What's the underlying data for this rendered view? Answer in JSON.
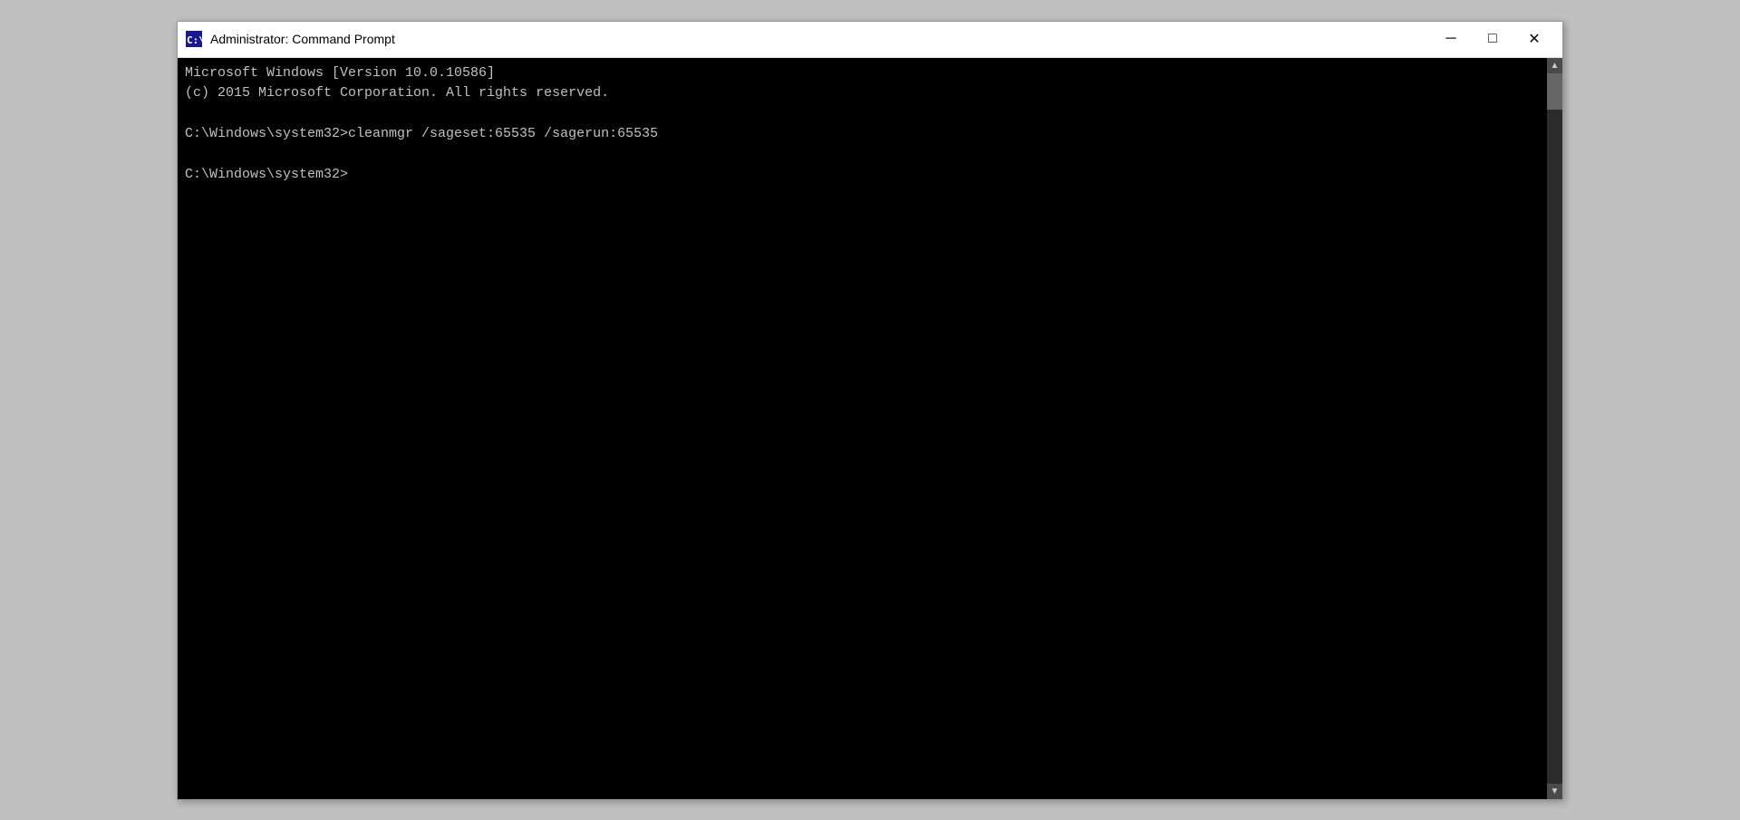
{
  "window": {
    "title": "Administrator: Command Prompt",
    "icon_label": "cmd-icon"
  },
  "titlebar": {
    "minimize_label": "─",
    "maximize_label": "□",
    "close_label": "✕"
  },
  "terminal": {
    "line1": "Microsoft Windows [Version 10.0.10586]",
    "line2": "(c) 2015 Microsoft Corporation. All rights reserved.",
    "line3": "",
    "line4": "C:\\Windows\\system32>cleanmgr /sageset:65535 /sagerun:65535",
    "line5": "",
    "line6": "C:\\Windows\\system32>"
  }
}
